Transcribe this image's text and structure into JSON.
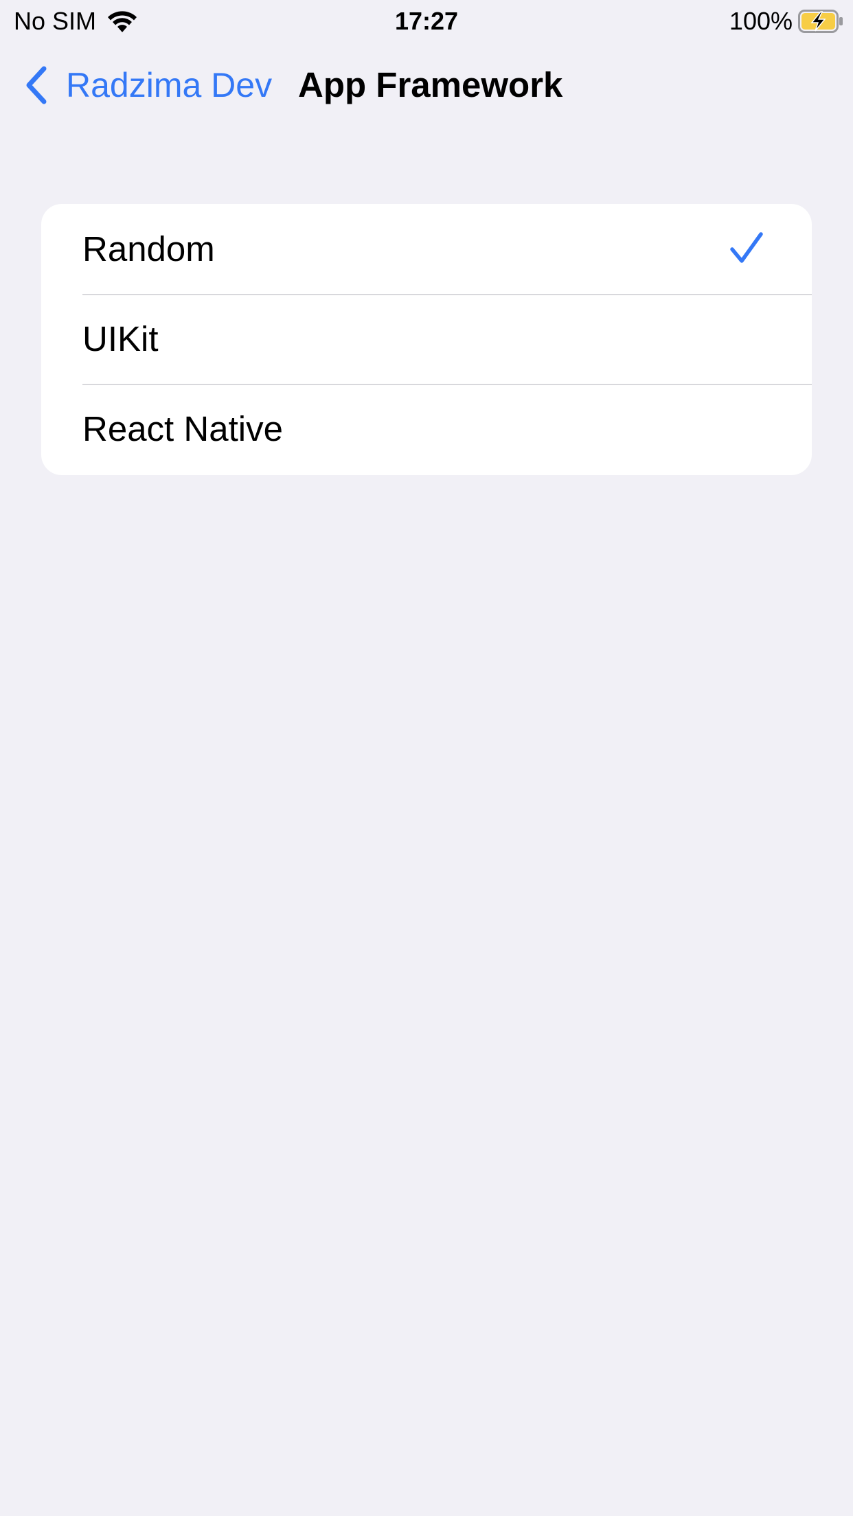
{
  "status_bar": {
    "carrier": "No SIM",
    "time": "17:27",
    "battery_percent": "100%",
    "battery_level": 1.0,
    "charging": true,
    "battery_fill_color": "#f7cd46",
    "icons": [
      "wifi-icon",
      "battery-charging-icon"
    ]
  },
  "nav": {
    "back_label": "Radzima Dev",
    "back_icon": "chevron-left-icon",
    "title": "App Framework",
    "accent_color": "#3478f6"
  },
  "options": {
    "items": [
      {
        "label": "Random",
        "selected": true
      },
      {
        "label": "UIKit",
        "selected": false
      },
      {
        "label": "React Native",
        "selected": false
      }
    ],
    "check_icon": "checkmark-icon"
  }
}
